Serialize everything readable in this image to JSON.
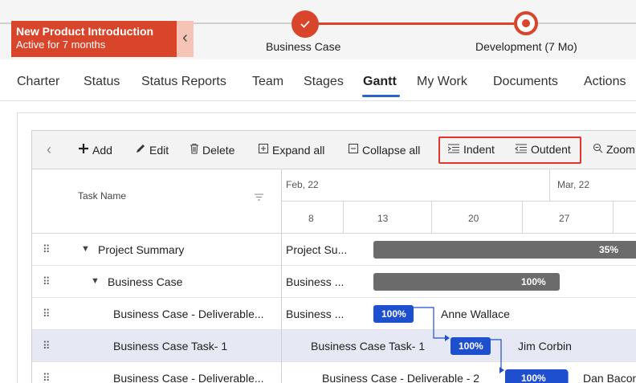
{
  "project": {
    "name": "New Product Introduction",
    "status": "Active for 7 months",
    "collapse_glyph": "‹"
  },
  "stages": [
    {
      "label": "Business Case",
      "state": "done"
    },
    {
      "label": "Development (7 Mo)",
      "state": "current"
    }
  ],
  "stage_colors": {
    "active": "#d9452b",
    "inactive": "#cfcfcf"
  },
  "tabs": [
    {
      "label": "Charter",
      "active": false
    },
    {
      "label": "Status",
      "active": false
    },
    {
      "label": "Status Reports",
      "active": false
    },
    {
      "label": "Team",
      "active": false
    },
    {
      "label": "Stages",
      "active": false
    },
    {
      "label": "Gantt",
      "active": true
    },
    {
      "label": "My Work",
      "active": false
    },
    {
      "label": "Documents",
      "active": false
    },
    {
      "label": "Actions",
      "active": false
    }
  ],
  "toolbar": {
    "back_glyph": "‹",
    "add": "Add",
    "edit": "Edit",
    "delete": "Delete",
    "expand_all": "Expand all",
    "collapse_all": "Collapse all",
    "indent": "Indent",
    "outdent": "Outdent",
    "zoom": "Zoom"
  },
  "grid": {
    "task_header": "Task Name",
    "months": [
      "Feb, 22",
      "Mar, 22"
    ],
    "days": [
      "8",
      "13",
      "20",
      "27"
    ]
  },
  "rows": [
    {
      "name": "Project Summary",
      "expandable": true,
      "bar_label": "Project Su...",
      "progress": "35%"
    },
    {
      "name": "Business Case",
      "expandable": true,
      "bar_label": "Business ...",
      "progress": "100%"
    },
    {
      "name": "Business Case - Deliverable...",
      "expandable": false,
      "bar_label": "Business ...",
      "progress": "100%",
      "assignee": "Anne Wallace"
    },
    {
      "name": "Business Case Task- 1",
      "expandable": false,
      "bar_label": "Business Case Task- 1",
      "progress": "100%",
      "assignee": "Jim Corbin",
      "selected": true
    },
    {
      "name": "Business Case - Deliverable...",
      "expandable": false,
      "bar_label": "Business Case - Deliverable - 2",
      "progress": "100%",
      "assignee": "Dan Bacon"
    }
  ],
  "colors": {
    "summary_bar": "#6b6b6b",
    "task_bar": "#1e4fcf",
    "highlight": "#e0342f",
    "selected_row": "#e6e8f4"
  },
  "icons": {
    "add": "plus-icon",
    "edit": "pencil-icon",
    "delete": "trash-icon",
    "expand_all": "expand-all-icon",
    "collapse_all": "collapse-all-icon",
    "indent": "indent-icon",
    "outdent": "outdent-icon",
    "zoom": "zoom-icon",
    "filter": "filter-icon",
    "drag": "drag-handle-icon",
    "caret": "caret-down-icon",
    "done": "check-icon"
  }
}
